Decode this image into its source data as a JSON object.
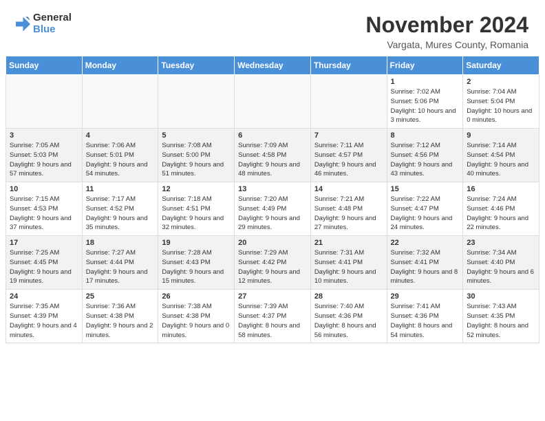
{
  "header": {
    "logo_general": "General",
    "logo_blue": "Blue",
    "month_title": "November 2024",
    "location": "Vargata, Mures County, Romania"
  },
  "weekdays": [
    "Sunday",
    "Monday",
    "Tuesday",
    "Wednesday",
    "Thursday",
    "Friday",
    "Saturday"
  ],
  "weeks": [
    [
      {
        "day": "",
        "info": ""
      },
      {
        "day": "",
        "info": ""
      },
      {
        "day": "",
        "info": ""
      },
      {
        "day": "",
        "info": ""
      },
      {
        "day": "",
        "info": ""
      },
      {
        "day": "1",
        "info": "Sunrise: 7:02 AM\nSunset: 5:06 PM\nDaylight: 10 hours\nand 3 minutes."
      },
      {
        "day": "2",
        "info": "Sunrise: 7:04 AM\nSunset: 5:04 PM\nDaylight: 10 hours\nand 0 minutes."
      }
    ],
    [
      {
        "day": "3",
        "info": "Sunrise: 7:05 AM\nSunset: 5:03 PM\nDaylight: 9 hours\nand 57 minutes."
      },
      {
        "day": "4",
        "info": "Sunrise: 7:06 AM\nSunset: 5:01 PM\nDaylight: 9 hours\nand 54 minutes."
      },
      {
        "day": "5",
        "info": "Sunrise: 7:08 AM\nSunset: 5:00 PM\nDaylight: 9 hours\nand 51 minutes."
      },
      {
        "day": "6",
        "info": "Sunrise: 7:09 AM\nSunset: 4:58 PM\nDaylight: 9 hours\nand 48 minutes."
      },
      {
        "day": "7",
        "info": "Sunrise: 7:11 AM\nSunset: 4:57 PM\nDaylight: 9 hours\nand 46 minutes."
      },
      {
        "day": "8",
        "info": "Sunrise: 7:12 AM\nSunset: 4:56 PM\nDaylight: 9 hours\nand 43 minutes."
      },
      {
        "day": "9",
        "info": "Sunrise: 7:14 AM\nSunset: 4:54 PM\nDaylight: 9 hours\nand 40 minutes."
      }
    ],
    [
      {
        "day": "10",
        "info": "Sunrise: 7:15 AM\nSunset: 4:53 PM\nDaylight: 9 hours\nand 37 minutes."
      },
      {
        "day": "11",
        "info": "Sunrise: 7:17 AM\nSunset: 4:52 PM\nDaylight: 9 hours\nand 35 minutes."
      },
      {
        "day": "12",
        "info": "Sunrise: 7:18 AM\nSunset: 4:51 PM\nDaylight: 9 hours\nand 32 minutes."
      },
      {
        "day": "13",
        "info": "Sunrise: 7:20 AM\nSunset: 4:49 PM\nDaylight: 9 hours\nand 29 minutes."
      },
      {
        "day": "14",
        "info": "Sunrise: 7:21 AM\nSunset: 4:48 PM\nDaylight: 9 hours\nand 27 minutes."
      },
      {
        "day": "15",
        "info": "Sunrise: 7:22 AM\nSunset: 4:47 PM\nDaylight: 9 hours\nand 24 minutes."
      },
      {
        "day": "16",
        "info": "Sunrise: 7:24 AM\nSunset: 4:46 PM\nDaylight: 9 hours\nand 22 minutes."
      }
    ],
    [
      {
        "day": "17",
        "info": "Sunrise: 7:25 AM\nSunset: 4:45 PM\nDaylight: 9 hours\nand 19 minutes."
      },
      {
        "day": "18",
        "info": "Sunrise: 7:27 AM\nSunset: 4:44 PM\nDaylight: 9 hours\nand 17 minutes."
      },
      {
        "day": "19",
        "info": "Sunrise: 7:28 AM\nSunset: 4:43 PM\nDaylight: 9 hours\nand 15 minutes."
      },
      {
        "day": "20",
        "info": "Sunrise: 7:29 AM\nSunset: 4:42 PM\nDaylight: 9 hours\nand 12 minutes."
      },
      {
        "day": "21",
        "info": "Sunrise: 7:31 AM\nSunset: 4:41 PM\nDaylight: 9 hours\nand 10 minutes."
      },
      {
        "day": "22",
        "info": "Sunrise: 7:32 AM\nSunset: 4:41 PM\nDaylight: 9 hours\nand 8 minutes."
      },
      {
        "day": "23",
        "info": "Sunrise: 7:34 AM\nSunset: 4:40 PM\nDaylight: 9 hours\nand 6 minutes."
      }
    ],
    [
      {
        "day": "24",
        "info": "Sunrise: 7:35 AM\nSunset: 4:39 PM\nDaylight: 9 hours\nand 4 minutes."
      },
      {
        "day": "25",
        "info": "Sunrise: 7:36 AM\nSunset: 4:38 PM\nDaylight: 9 hours\nand 2 minutes."
      },
      {
        "day": "26",
        "info": "Sunrise: 7:38 AM\nSunset: 4:38 PM\nDaylight: 9 hours\nand 0 minutes."
      },
      {
        "day": "27",
        "info": "Sunrise: 7:39 AM\nSunset: 4:37 PM\nDaylight: 8 hours\nand 58 minutes."
      },
      {
        "day": "28",
        "info": "Sunrise: 7:40 AM\nSunset: 4:36 PM\nDaylight: 8 hours\nand 56 minutes."
      },
      {
        "day": "29",
        "info": "Sunrise: 7:41 AM\nSunset: 4:36 PM\nDaylight: 8 hours\nand 54 minutes."
      },
      {
        "day": "30",
        "info": "Sunrise: 7:43 AM\nSunset: 4:35 PM\nDaylight: 8 hours\nand 52 minutes."
      }
    ]
  ]
}
